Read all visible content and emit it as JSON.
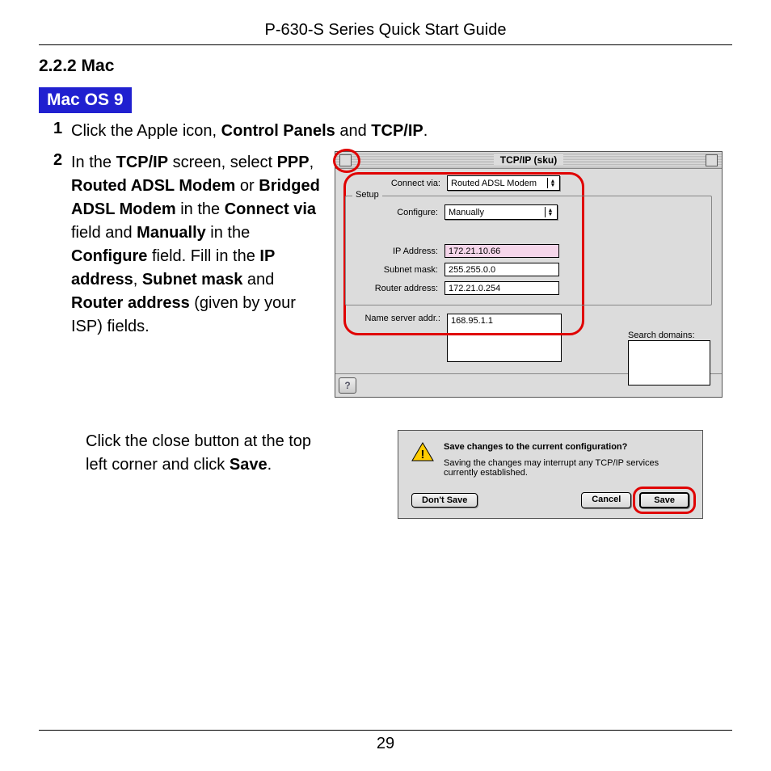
{
  "header": {
    "title": "P-630-S Series Quick Start Guide"
  },
  "section": {
    "number": "2.2.2 Mac",
    "badge": "Mac OS 9"
  },
  "steps": {
    "s1": {
      "num": "1"
    },
    "s2": {
      "num": "2"
    }
  },
  "text": {
    "step1_a": "Click the Apple icon, ",
    "step1_b": "Control Panels",
    "step1_c": " and ",
    "step1_d": "TCP/IP",
    "step1_e": ".",
    "step2_a": "In the ",
    "step2_b": "TCP/IP",
    "step2_c": " screen, select ",
    "step2_d": "PPP",
    "step2_e": ", ",
    "step2_f": "Routed ADSL Modem",
    "step2_g": " or ",
    "step2_h": "Bridged ADSL Modem",
    "step2_i": " in the ",
    "step2_j": "Connect via",
    "step2_k": " field and ",
    "step2_l": "Manually",
    "step2_m": " in the ",
    "step2_n": "Configure",
    "step2_o": " field. Fill in the ",
    "step2_p": "IP address",
    "step2_q": ", ",
    "step2_r": "Subnet mask",
    "step2_s": " and ",
    "step2_t": "Router address",
    "step2_u": " (given by your ISP) fields.",
    "step3_a": "Click the close button at the top left corner and click ",
    "step3_b": "Save",
    "step3_c": "."
  },
  "tcpip": {
    "windowTitle": "TCP/IP (sku)",
    "labels": {
      "connectVia": "Connect via:",
      "setup": "Setup",
      "configure": "Configure:",
      "ipAddress": "IP Address:",
      "subnetMask": "Subnet mask:",
      "routerAddress": "Router address:",
      "nameServer": "Name server addr.:",
      "searchDomains": "Search domains:"
    },
    "values": {
      "connectVia": "Routed ADSL Modem",
      "configure": "Manually",
      "ipAddress": "172.21.10.66",
      "subnetMask": "255.255.0.0",
      "routerAddress": "172.21.0.254",
      "nameServer": "168.95.1.1"
    },
    "help": "?"
  },
  "dialog": {
    "title": "Save changes to the current configuration?",
    "body": "Saving the changes may interrupt any TCP/IP services currently established.",
    "buttons": {
      "dontSave": "Don't Save",
      "cancel": "Cancel",
      "save": "Save"
    }
  },
  "footer": {
    "page": "29"
  }
}
